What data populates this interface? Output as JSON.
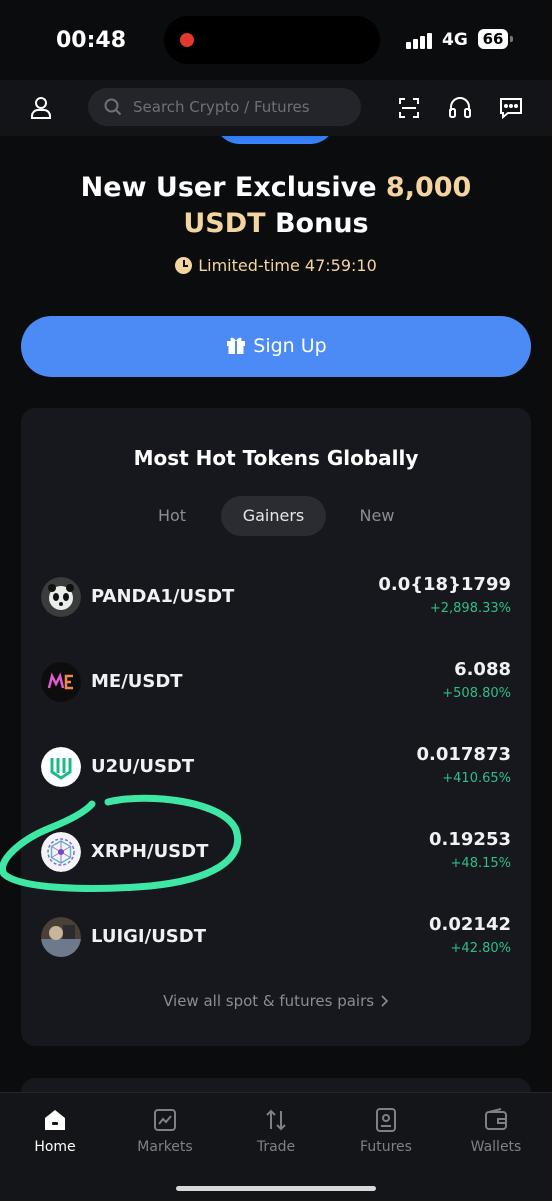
{
  "status_bar": {
    "time": "00:48",
    "network": "4G",
    "battery": "66"
  },
  "top_nav": {
    "search_placeholder": "Search Crypto / Futures",
    "icons": [
      "user-icon",
      "scan-icon",
      "headset-icon",
      "chat-icon"
    ]
  },
  "hero": {
    "title_part1": "New User Exclusive ",
    "title_highlight1": "8,000",
    "title_highlight2": "USDT",
    "title_part2": " Bonus",
    "timer_label": "Limited-time 47:59:10",
    "signup_label": "Sign Up"
  },
  "hot_tokens": {
    "title": "Most Hot Tokens Globally",
    "tabs": [
      {
        "label": "Hot",
        "active": false
      },
      {
        "label": "Gainers",
        "active": true
      },
      {
        "label": "New",
        "active": false
      }
    ],
    "rows": [
      {
        "pair": "PANDA1/USDT",
        "price": "0.0{18}1799",
        "change": "+2,898.33%"
      },
      {
        "pair": "ME/USDT",
        "price": "6.088",
        "change": "+508.80%"
      },
      {
        "pair": "U2U/USDT",
        "price": "0.017873",
        "change": "+410.65%"
      },
      {
        "pair": "XRPH/USDT",
        "price": "0.19253",
        "change": "+48.15%"
      },
      {
        "pair": "LUIGI/USDT",
        "price": "0.02142",
        "change": "+42.80%"
      }
    ],
    "view_all": "View all spot & futures pairs"
  },
  "bottom_nav": [
    {
      "label": "Home",
      "active": true
    },
    {
      "label": "Markets",
      "active": false
    },
    {
      "label": "Trade",
      "active": false
    },
    {
      "label": "Futures",
      "active": false
    },
    {
      "label": "Wallets",
      "active": false
    }
  ],
  "colors": {
    "accent": "#4c8bf5",
    "gold": "#f5d59f",
    "gain": "#2ebd85",
    "annotation": "#3ee8a4"
  }
}
